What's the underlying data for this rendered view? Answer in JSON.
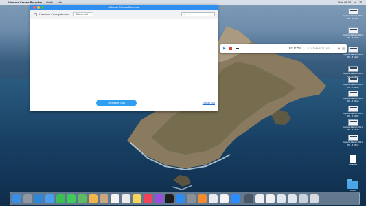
{
  "menubar": {
    "app_name": "Vidmore Screen Recorder",
    "menus": [
      "Outils",
      "Aide"
    ],
    "right_text": "Mar. 08:28"
  },
  "window": {
    "title": "Vidmore Screen Recorder",
    "toolbar": {
      "history_label": "Historique d'enregistrement",
      "filter_selected": "Afficher tout"
    },
    "record_button_label": "Enregistrer plus",
    "clear_link_label": "Effacer tout"
  },
  "recorder_bar": {
    "time": "00:07:50",
    "size": "17.67 MB/85717 KB"
  },
  "desktop": {
    "items": [
      {
        "label": "Capture d'écran 2021-05-...8.50.34"
      },
      {
        "label": "Capture d'écran 2021-05-...8.51.02"
      },
      {
        "label": "Capture d'écran 2021-05-...8.51.24"
      },
      {
        "label": "Capture d'écran 2021-05-...8.52.10"
      },
      {
        "label": "Capture d'écran 2021-05-...8.52.44"
      },
      {
        "label": "Capture d'écran 2021-05-...8.53.18"
      },
      {
        "label": "Capture d'écran 2021-05-...8.54.02"
      },
      {
        "label": "Capture d'écran 2021-05-...8.54.40"
      },
      {
        "label": "Capture d'écran 2021-05-...8.55.12"
      }
    ],
    "document_label": "WEBVTT",
    "folder_label": "MIMC"
  },
  "dock": {
    "icons": [
      {
        "name": "finder-icon",
        "color": "#3a8ee6"
      },
      {
        "name": "launchpad-icon",
        "color": "#8f98a3"
      },
      {
        "name": "safari-icon",
        "color": "#2f86d8"
      },
      {
        "name": "mail-icon",
        "color": "#4a9df0"
      },
      {
        "name": "facetime-icon",
        "color": "#3bbf55"
      },
      {
        "name": "messages-icon",
        "color": "#41c95a"
      },
      {
        "name": "maps-icon",
        "color": "#5dbb63"
      },
      {
        "name": "photos-icon",
        "color": "#f0b64a"
      },
      {
        "name": "contacts-icon",
        "color": "#c9a780"
      },
      {
        "name": "calendar-icon",
        "color": "#f4f4f4"
      },
      {
        "name": "reminders-icon",
        "color": "#ececec"
      },
      {
        "name": "notes-icon",
        "color": "#f3d65a"
      },
      {
        "name": "music-icon",
        "color": "#f2435a"
      },
      {
        "name": "podcasts-icon",
        "color": "#9b4de0"
      },
      {
        "name": "appletv-icon",
        "color": "#1d1d1f"
      },
      {
        "name": "appstore-icon",
        "color": "#2d8cf0"
      },
      {
        "name": "system-preferences-icon",
        "color": "#8b8f96"
      },
      {
        "name": "books-icon",
        "color": "#f28a30"
      },
      {
        "name": "preview-icon",
        "color": "#e9ecef"
      },
      {
        "name": "textedit-icon",
        "color": "#f4f4f4"
      },
      {
        "name": "zoom-icon",
        "color": "#2d8cff"
      },
      {
        "name": "screenshot-app-icon",
        "color": "#4b5563"
      },
      {
        "name": "document-icon-1",
        "color": "#eef0f2"
      },
      {
        "name": "document-icon-2",
        "color": "#eef0f2"
      },
      {
        "name": "document-icon-3",
        "color": "#dfe6ee"
      },
      {
        "name": "document-icon-4",
        "color": "#dfe6ee"
      },
      {
        "name": "document-icon-5",
        "color": "#c7d2dd"
      },
      {
        "name": "trash-icon",
        "color": "#d7dbe0"
      }
    ]
  }
}
